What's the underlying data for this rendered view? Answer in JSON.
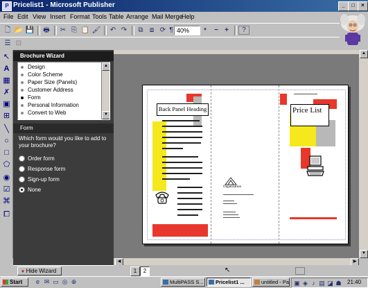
{
  "window": {
    "title": "Pricelist1 - Microsoft Publisher"
  },
  "menu": [
    "File",
    "Edit",
    "View",
    "Insert",
    "Format",
    "Tools",
    "Table",
    "Arrange",
    "Mail Merge",
    "Help"
  ],
  "toolbar": {
    "zoom": "40%",
    "zoom_out": "−",
    "zoom_in": "+"
  },
  "wizard": {
    "title": "Brochure Wizard",
    "steps": [
      "Design",
      "Color Scheme",
      "Paper Size (Panels)",
      "Customer Address",
      "Form",
      "Personal Information",
      "Convert to Web"
    ],
    "active_step": "Form",
    "section_title": "Form",
    "question": "Which form would you like to add to your brochure?",
    "options": [
      "Order form",
      "Response form",
      "Sign-up form",
      "None"
    ],
    "selected_option": "None",
    "hide_label": "Hide Wizard"
  },
  "pages": [
    "1",
    "2"
  ],
  "current_page": "2",
  "brochure": {
    "back_heading": "Back Panel Heading",
    "price_list": "Price List",
    "organization": "Organization",
    "accent_red": "#e8372c",
    "accent_yellow": "#f5e81c",
    "accent_gray": "#b8b8b8"
  },
  "taskbar": {
    "start": "Start",
    "buttons": [
      "MultiPASS S...",
      "Pricelist1 ...",
      "untitled - Paint"
    ],
    "active": "Pricelist1 ...",
    "clock": "21:40"
  }
}
